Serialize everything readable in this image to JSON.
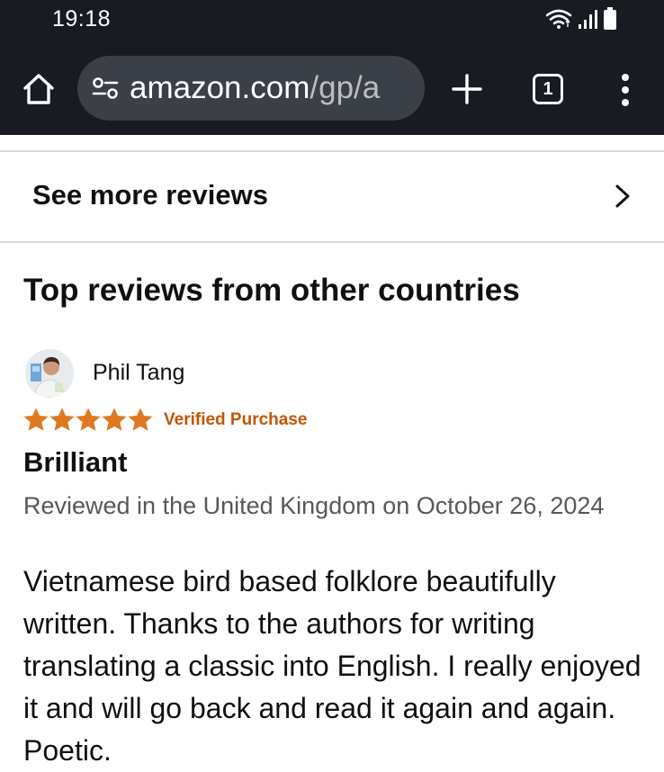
{
  "status_bar": {
    "time": "19:18"
  },
  "browser": {
    "url_domain": "amazon.com",
    "url_path": "/gp/a",
    "tab_count": "1"
  },
  "see_more": {
    "label": "See more reviews"
  },
  "section": {
    "title": "Top reviews from other countries"
  },
  "review": {
    "reviewer_name": "Phil Tang",
    "rating": 5,
    "rating_max": 5,
    "verified_label": "Verified Purchase",
    "title": "Brilliant",
    "meta": "Reviewed in the United Kingdom on October 26, 2024",
    "body": "Vietnamese bird based folklore beautifully written. Thanks to the authors for writing translating a classic into English. I really enjoyed it and will go back and read it again and again. Poetic."
  },
  "colors": {
    "chrome_bg": "#181b21",
    "url_pill_bg": "#3b3f47",
    "star": "#de7921",
    "verified": "#c45500",
    "meta_text": "#565959"
  },
  "icons": {
    "home": "home-icon",
    "site_settings": "site-settings-icon",
    "new_tab": "plus-icon",
    "tabs": "tab-switcher-icon",
    "menu": "more-vert-icon",
    "chevron": "chevron-right-icon",
    "wifi": "wifi-icon",
    "signal": "signal-icon",
    "battery": "battery-icon",
    "star": "star-icon"
  }
}
